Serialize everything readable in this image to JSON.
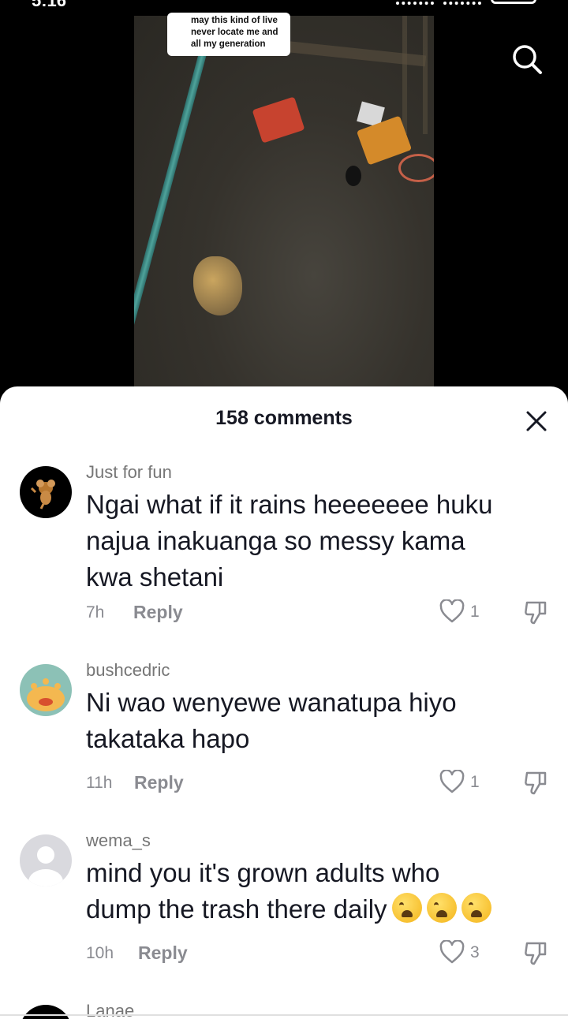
{
  "status_bar": {
    "time": "5:16"
  },
  "video": {
    "caption_lines": [
      "may this kind of live",
      "never locate me and",
      "all my generation"
    ],
    "search_icon": "search-icon"
  },
  "comments_sheet": {
    "title": "158 comments",
    "close_icon": "close-icon",
    "comments": [
      {
        "username": "Just for fun",
        "text_lines": [
          "Ngai what if it rains heeeeeee huku",
          "najua inakuanga so messy kama",
          "kwa shetani"
        ],
        "time": "7h",
        "reply_label": "Reply",
        "likes": "1"
      },
      {
        "username": "bushcedric",
        "text_lines": [
          "Ni wao wenyewe wanatupa hiyo",
          "takataka hapo"
        ],
        "time": "11h",
        "reply_label": "Reply",
        "likes": "1"
      },
      {
        "username": "wema_s",
        "text_lines": [
          "mind you it's grown adults who",
          "dump the trash there daily"
        ],
        "emoji_count": 3,
        "emoji_name": "weary-face-emoji",
        "time": "10h",
        "reply_label": "Reply",
        "likes": "3"
      },
      {
        "username": "Lanae"
      }
    ]
  },
  "colors": {
    "accent_text": "#161823",
    "muted_text": "#8a8b91",
    "sheet_bg": "#ffffff",
    "video_bg": "#000000"
  }
}
